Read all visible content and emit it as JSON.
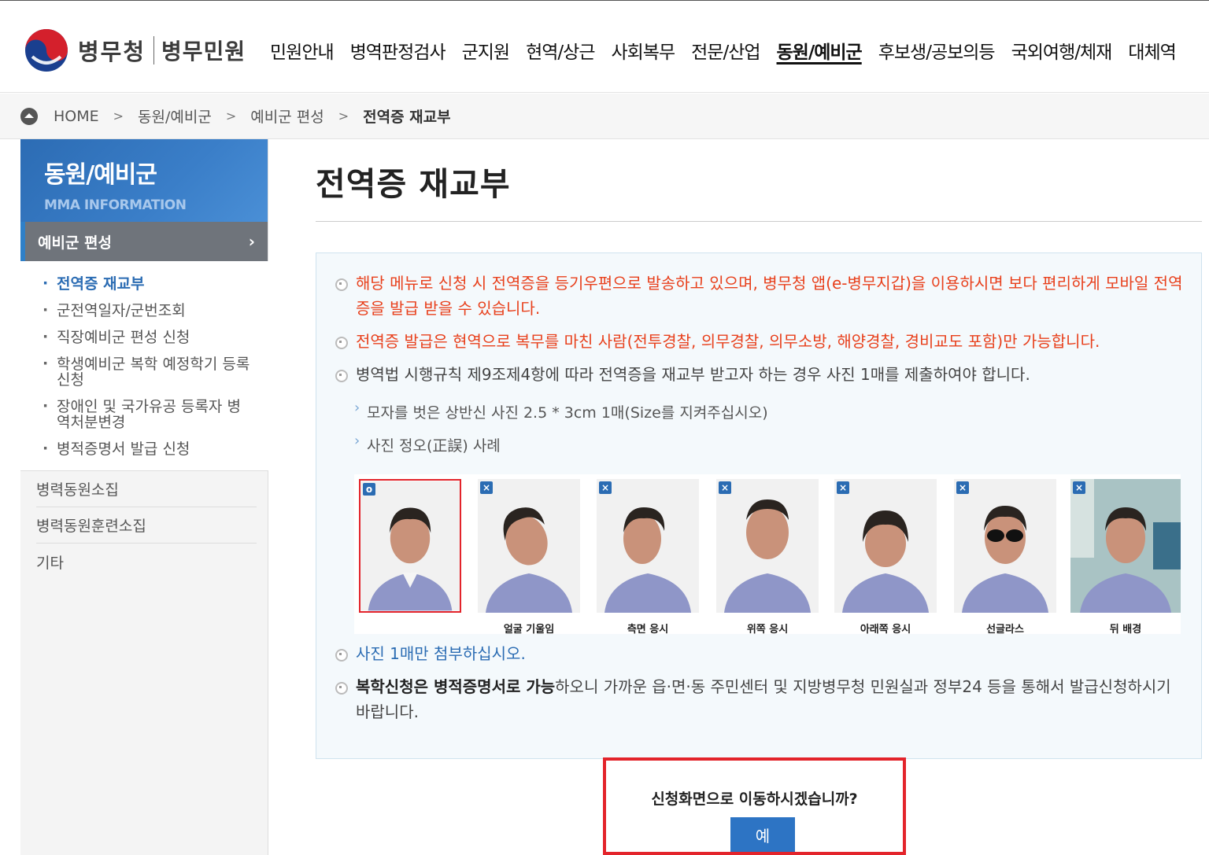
{
  "header": {
    "logo_text": "병무청",
    "logo_sub": "병무민원",
    "nav": [
      "민원안내",
      "병역판정검사",
      "군지원",
      "현역/상근",
      "사회복무",
      "전문/산업",
      "동원/예비군",
      "후보생/공보의등",
      "국외여행/체재",
      "대체역"
    ],
    "nav_active_index": 6
  },
  "breadcrumb": {
    "home": "HOME",
    "sep": ">",
    "items": [
      "동원/예비군",
      "예비군 편성",
      "전역증 재교부"
    ]
  },
  "sidebar": {
    "title": "동원/예비군",
    "subtitle": "MMA INFORMATION",
    "active_section": "예비군 편성",
    "active_chevron": "›",
    "sub_items": [
      "전역증 재교부",
      "군전역일자/군번조회",
      "직장예비군 편성 신청",
      "학생예비군 복학 예정학기 등록 신청",
      "장애인 및 국가유공 등록자 병역처분변경",
      "병적증명서 발급 신청"
    ],
    "links": [
      "병력동원소집",
      "병력동원훈련소집",
      "기타"
    ]
  },
  "main": {
    "title": "전역증 재교부",
    "bullet1": "해당 메뉴로 신청 시 전역증을 등기우편으로 발송하고 있으며, 병무청 앱(e-병무지갑)을 이용하시면 보다 편리하게 모바일 전역증을 발급 받을 수 있습니다.",
    "bullet2": "전역증 발급은 현역으로 복무를 마친 사람(전투경찰, 의무경찰, 의무소방, 해양경찰, 경비교도 포함)만 가능합니다.",
    "bullet3": "병역법 시행규칙 제9조제4항에 따라 전역증을 재교부 받고자 하는 경우 사진 1매를 제출하여야 합니다.",
    "sub1": "모자를 벗은 상반신 사진 2.5 * 3cm 1매(Size를 지켜주십시오)",
    "sub2": "사진 정오(正誤) 사례",
    "bullet4": "사진 1매만 첨부하십시오.",
    "bullet5_bold": "복학신청은 병적증명서로 가능",
    "bullet5_rest": "하오니 가까운 읍·면·동 주민센터 및 지방병무청 민원실과 정부24 등을 통해서 발급신청하시기 바랍니다.",
    "photos": [
      {
        "mark": "o",
        "caption": ""
      },
      {
        "mark": "×",
        "caption": "얼굴 기울임"
      },
      {
        "mark": "×",
        "caption": "측면 응시"
      },
      {
        "mark": "×",
        "caption": "위쪽 응시"
      },
      {
        "mark": "×",
        "caption": "아래쪽 응시"
      },
      {
        "mark": "×",
        "caption": "선글라스"
      },
      {
        "mark": "×",
        "caption": "뒤 배경"
      }
    ]
  },
  "confirm": {
    "question": "신청화면으로 이동하시겠습니까?",
    "yes": "예"
  }
}
